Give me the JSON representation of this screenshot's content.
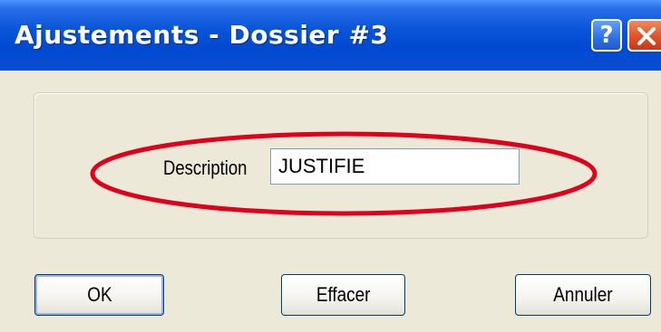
{
  "window": {
    "title": "Ajustements - Dossier #3"
  },
  "titlebar": {
    "help_label": "?"
  },
  "form": {
    "description_label": "Description",
    "description_value": "JUSTIFIE"
  },
  "buttons": {
    "ok_label": "OK",
    "clear_label": "Effacer",
    "cancel_label": "Annuler"
  },
  "annotation": {
    "color": "#e0001b"
  },
  "colors": {
    "titlebar": "#0a55d9",
    "dialog_background": "#ece9d8",
    "close_button": "#e0522a"
  },
  "icons": {
    "help": "question-mark-icon",
    "close": "close-x-icon"
  }
}
